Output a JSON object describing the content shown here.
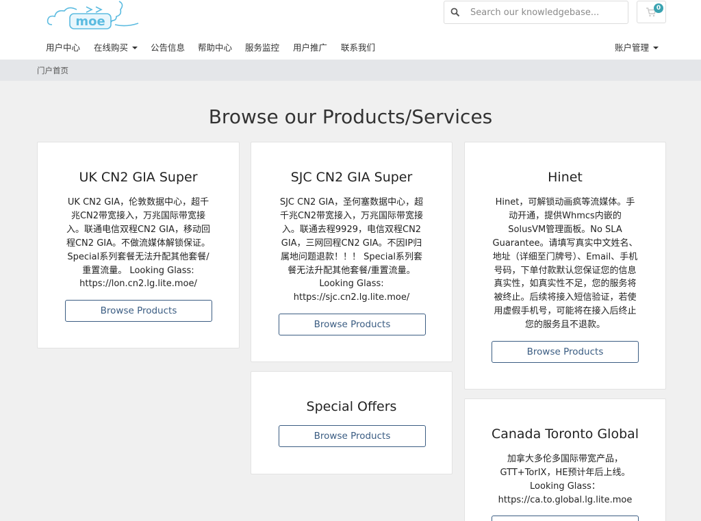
{
  "header": {
    "logo_text": "moe",
    "search": {
      "placeholder": "Search our knowledgebase...",
      "value": ""
    },
    "cart_count": "0"
  },
  "nav": {
    "items": [
      {
        "label": "用户中心",
        "dropdown": false
      },
      {
        "label": "在线购买",
        "dropdown": true
      },
      {
        "label": "公告信息",
        "dropdown": false
      },
      {
        "label": "帮助中心",
        "dropdown": false
      },
      {
        "label": "服务监控",
        "dropdown": false
      },
      {
        "label": "用户推广",
        "dropdown": false
      },
      {
        "label": "联系我们",
        "dropdown": false
      }
    ],
    "account": {
      "label": "账户管理",
      "dropdown": true
    }
  },
  "breadcrumb": {
    "home": "门户首页"
  },
  "main": {
    "title": "Browse our Products/Services",
    "button_label": "Browse Products",
    "cards": [
      {
        "title": "UK CN2 GIA Super",
        "desc_lines": [
          "UK CN2 GIA，伦敦数据中心，超千",
          "兆CN2带宽接入，万兆国际带宽接",
          "入。联通电信双程CN2 GIA，移动回",
          "程CN2 GIA。不做流媒体解锁保证。",
          "Special系列套餐无法升配其他套餐/",
          "重置流量。 Looking Glass:",
          "https://lon.cn2.lg.lite.moe/"
        ]
      },
      {
        "title": "SJC CN2 GIA Super",
        "desc_lines": [
          "SJC CN2 GIA，圣何塞数据中心，超",
          "千兆CN2带宽接入，万兆国际带宽接",
          "入。联通去程9929，电信双程CN2",
          "GIA，三网回程CN2 GIA。不因IP归",
          "属地问题退款！！！ Special系列套",
          "餐无法升配其他套餐/重置流量。",
          "Looking Glass:",
          "https://sjc.cn2.lg.lite.moe/"
        ]
      },
      {
        "title": "Hinet",
        "desc_lines": [
          "Hinet，可解锁动画疯等流媒体。手",
          "动开通，提供Whmcs内嵌的",
          "SolusVM管理面板。No SLA",
          "Guarantee。请填写真实中文姓名、",
          "地址（详细至门牌号）、Email、手机",
          "号码，下单付款默认您保证您的信息",
          "真实性，如真实性不足，您的服务将",
          "被终止。后续将接入短信验证，若使",
          "用虚假手机号，可能将在接入后终止",
          "您的服务且不退款。"
        ]
      },
      {
        "title": "Special Offers",
        "desc_lines": []
      },
      {
        "title": "Canada Toronto Global",
        "desc_lines": [
          "加拿大多伦多国际带宽产品，",
          "GTT+TorIX，HE预计年后上线。",
          "Looking Glass：",
          "https://ca.to.global.lg.lite.moe"
        ]
      }
    ]
  },
  "colors": {
    "accent": "#3a5c82",
    "badge": "#3aa3b1",
    "page_bg": "#f0f0f0",
    "crumb_bg": "#e4e6e9"
  },
  "icons": {
    "search": "search-icon",
    "cart": "cart-icon"
  }
}
